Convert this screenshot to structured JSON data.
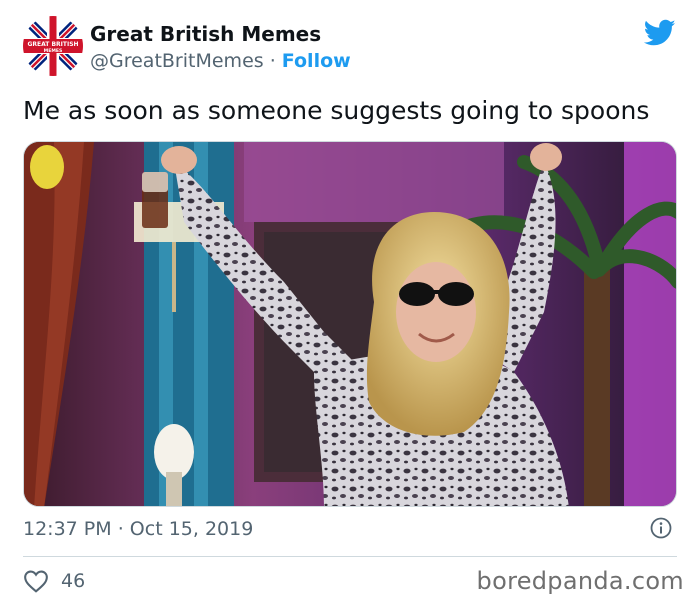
{
  "tweet": {
    "author_name": "Great British Memes",
    "author_handle": "@GreatBritMemes",
    "separator": "·",
    "follow_label": "Follow",
    "text": "Me as soon as someone suggests going to spoons",
    "time": "12:37 PM",
    "date": "Oct 15, 2019",
    "likes": "46"
  },
  "avatar": {
    "logo_text_top": "GREAT BRITISH",
    "logo_text_bottom": "MEMES"
  },
  "watermark": "boredpanda.com",
  "colors": {
    "accent": "#1d9bf0",
    "text": "#0f1419",
    "secondary": "#536471",
    "border": "#cfd9de",
    "flag_red": "#cf142b",
    "flag_blue": "#00247d"
  },
  "icons": {
    "brand": "twitter-bird-icon",
    "info": "info-icon",
    "like": "heart-icon"
  }
}
